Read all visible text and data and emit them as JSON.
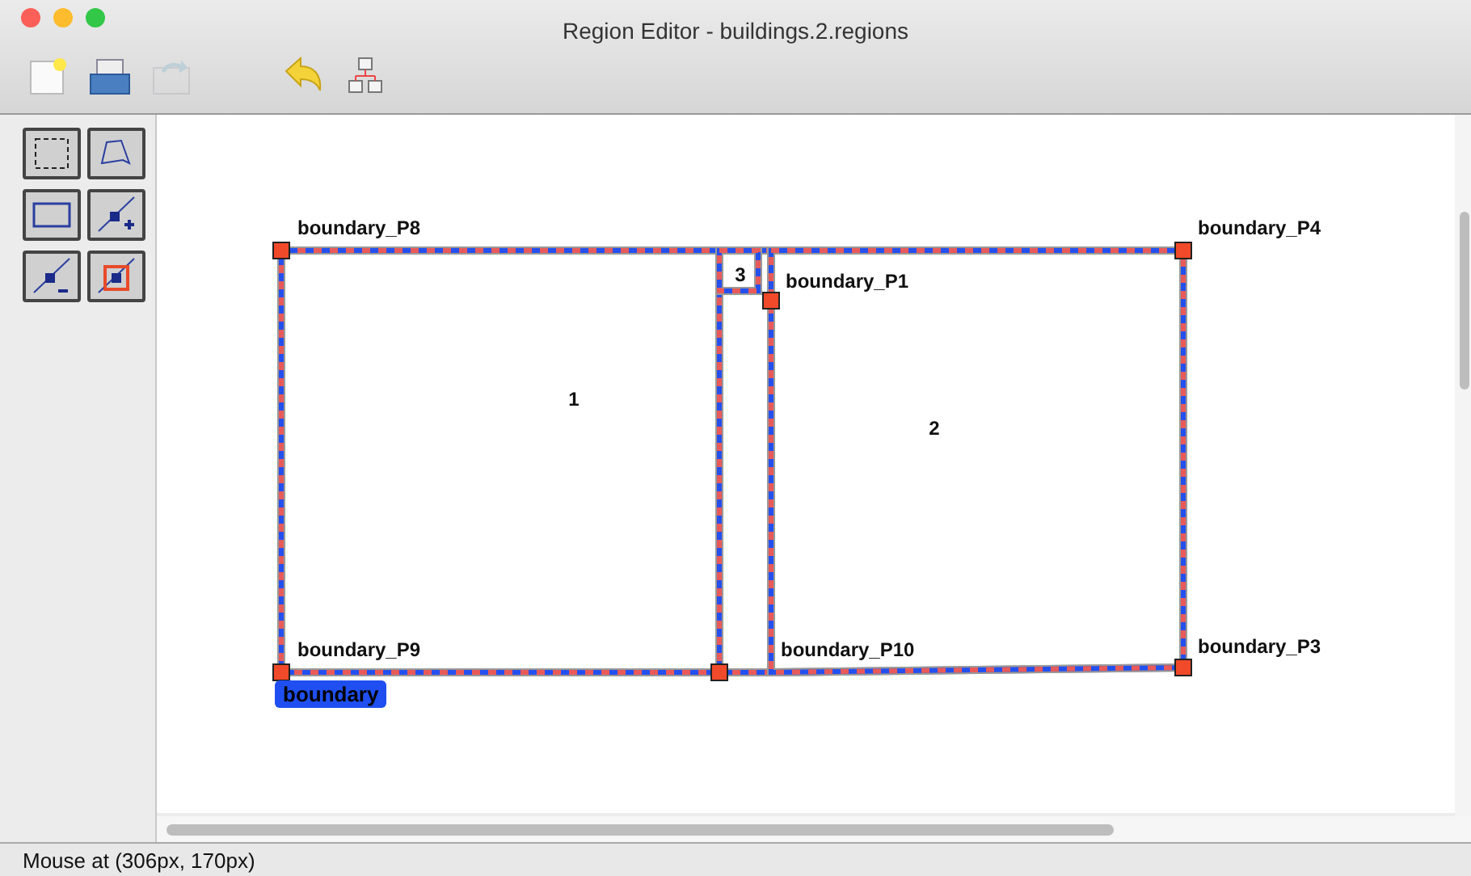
{
  "window": {
    "title": "Region Editor - buildings.2.regions"
  },
  "toolbar": [
    {
      "kind": "new",
      "disabled": false
    },
    {
      "kind": "open",
      "disabled": false
    },
    {
      "kind": "save",
      "disabled": true
    },
    {
      "kind": "gap"
    },
    {
      "kind": "undo",
      "disabled": false
    },
    {
      "kind": "hierarchy",
      "disabled": false
    }
  ],
  "tools": [
    {
      "kind": "select"
    },
    {
      "kind": "polygon"
    },
    {
      "kind": "rectangle"
    },
    {
      "kind": "add-point"
    },
    {
      "kind": "remove-point"
    },
    {
      "kind": "point-in-square"
    }
  ],
  "canvas": {
    "points": [
      {
        "label": "boundary_P8"
      },
      {
        "label": "boundary_P4"
      },
      {
        "label": "boundary_P1"
      },
      {
        "label": "boundary_P9"
      },
      {
        "label": "boundary_P10"
      },
      {
        "label": "boundary_P3"
      }
    ],
    "regions": [
      {
        "label": "3"
      },
      {
        "label": "1"
      },
      {
        "label": "2"
      }
    ],
    "selection": {
      "label": "boundary"
    }
  },
  "status_bar": {
    "text": "Mouse at (306px, 170px)"
  }
}
